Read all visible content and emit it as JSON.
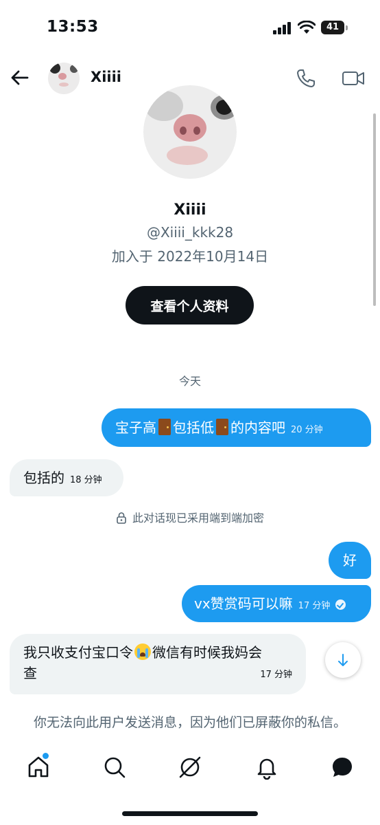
{
  "status_bar": {
    "time": "13:53",
    "battery": "41"
  },
  "header": {
    "name": "Xiiii"
  },
  "profile": {
    "name": "Xiiii",
    "handle": "@Xiiii_kkk28",
    "joined": "加入于 2022年10月14日",
    "view_profile_label": "查看个人资料"
  },
  "date_separator": "今天",
  "messages": [
    {
      "direction": "outgoing",
      "parts": [
        "宝子高",
        "包括低",
        "的内容吧"
      ],
      "time": "20 分钟"
    },
    {
      "direction": "incoming",
      "text": "包括的",
      "time": "18 分钟"
    },
    {
      "direction": "outgoing",
      "text": "好"
    },
    {
      "direction": "outgoing",
      "text": "vx赞赏码可以嘛",
      "time": "17 分钟",
      "status": "read"
    },
    {
      "direction": "incoming",
      "line1_before": "我只收支付宝口令",
      "line1_after": "微信有时候我妈会",
      "line2": "查",
      "time": "17 分钟"
    }
  ],
  "encryption_notice": "此对话现已采用端到端加密",
  "blocked_notice": "你无法向此用户发送消息，因为他们已屏蔽你的私信。",
  "icons": {
    "back": "arrow-left-icon",
    "call": "phone-icon",
    "video": "video-icon",
    "lock": "lock-icon",
    "scroll_down": "arrow-down-icon",
    "tabs": [
      "home-icon",
      "search-icon",
      "grok-icon",
      "bell-icon",
      "messages-icon"
    ]
  },
  "colors": {
    "accent": "#1d9bf0",
    "text": "#0f1419",
    "muted": "#536471",
    "incoming_bubble": "#eff3f4"
  }
}
